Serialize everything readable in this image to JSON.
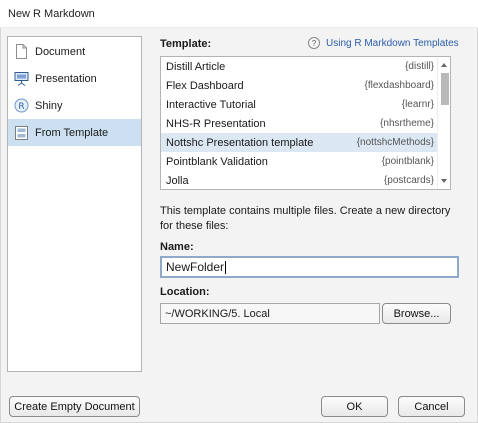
{
  "window": {
    "title": "New R Markdown"
  },
  "sidebar": {
    "items": [
      {
        "label": "Document",
        "icon": "document-icon",
        "selected": false
      },
      {
        "label": "Presentation",
        "icon": "presentation-icon",
        "selected": false
      },
      {
        "label": "Shiny",
        "icon": "shiny-icon",
        "selected": false
      },
      {
        "label": "From Template",
        "icon": "template-icon",
        "selected": true
      }
    ]
  },
  "template": {
    "label": "Template:",
    "help_link": "Using R Markdown Templates",
    "help_icon": "question-icon",
    "rows": [
      {
        "name": "Distill Article",
        "pkg": "{distill}"
      },
      {
        "name": "Flex Dashboard",
        "pkg": "{flexdashboard}"
      },
      {
        "name": "Interactive Tutorial",
        "pkg": "{learnr}"
      },
      {
        "name": "NHS-R Presentation",
        "pkg": "{nhsrtheme}"
      },
      {
        "name": "Nottshc Presentation template",
        "pkg": "{nottshcMethods}"
      },
      {
        "name": "Pointblank Validation",
        "pkg": "{pointblank}"
      },
      {
        "name": "Jolla",
        "pkg": "{postcards}"
      }
    ],
    "selected_index": 4
  },
  "info": {
    "line1": "This template contains multiple files. Create a new directory",
    "line2": "for these files:"
  },
  "name": {
    "label": "Name:",
    "value": "NewFolder"
  },
  "location": {
    "label": "Location:",
    "value": "~/WORKING/5. Local",
    "browse": "Browse..."
  },
  "buttons": {
    "create_empty": "Create Empty Document",
    "ok": "OK",
    "cancel": "Cancel"
  },
  "colors": {
    "selection": "#cde0f2",
    "link": "#2a5caa"
  }
}
